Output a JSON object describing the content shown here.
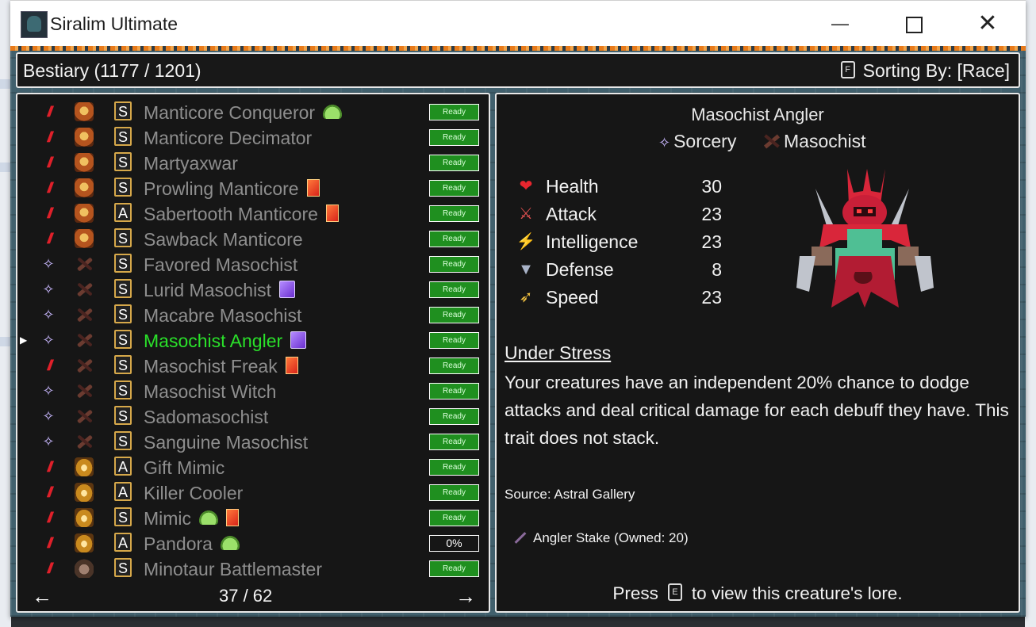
{
  "window": {
    "title": "Siralim Ultimate",
    "minimize_icon": "minimize-icon",
    "maximize_icon": "maximize-icon",
    "close_icon": "close-icon"
  },
  "header": {
    "title": "Bestiary (1177 / 1201)",
    "sort_key": "F",
    "sort_label": "Sorting By: [Race]"
  },
  "list": {
    "selected_index": 9,
    "rows": [
      {
        "klass": "nature",
        "race": "manticore",
        "rank": "S",
        "name": "Manticore Conqueror",
        "badges": [
          "slime"
        ],
        "status": "Ready"
      },
      {
        "klass": "nature",
        "race": "manticore",
        "rank": "S",
        "name": "Manticore Decimator",
        "badges": [],
        "status": "Ready"
      },
      {
        "klass": "nature",
        "race": "manticore",
        "rank": "S",
        "name": "Martyaxwar",
        "badges": [],
        "status": "Ready"
      },
      {
        "klass": "nature",
        "race": "manticore",
        "rank": "S",
        "name": "Prowling Manticore",
        "badges": [
          "card"
        ],
        "status": "Ready"
      },
      {
        "klass": "nature",
        "race": "manticore",
        "rank": "A",
        "name": "Sabertooth Manticore",
        "badges": [
          "card"
        ],
        "status": "Ready"
      },
      {
        "klass": "nature",
        "race": "manticore",
        "rank": "S",
        "name": "Sawback Manticore",
        "badges": [],
        "status": "Ready"
      },
      {
        "klass": "sorcery",
        "race": "masochist",
        "rank": "S",
        "name": "Favored Masochist",
        "badges": [],
        "status": "Ready"
      },
      {
        "klass": "sorcery",
        "race": "masochist",
        "rank": "S",
        "name": "Lurid Masochist",
        "badges": [
          "purple"
        ],
        "status": "Ready"
      },
      {
        "klass": "sorcery",
        "race": "masochist",
        "rank": "S",
        "name": "Macabre Masochist",
        "badges": [],
        "status": "Ready"
      },
      {
        "klass": "sorcery",
        "race": "masochist",
        "rank": "S",
        "name": "Masochist Angler",
        "badges": [
          "purple"
        ],
        "status": "Ready"
      },
      {
        "klass": "nature",
        "race": "masochist",
        "rank": "S",
        "name": "Masochist Freak",
        "badges": [
          "card"
        ],
        "status": "Ready"
      },
      {
        "klass": "sorcery",
        "race": "masochist",
        "rank": "S",
        "name": "Masochist Witch",
        "badges": [],
        "status": "Ready"
      },
      {
        "klass": "sorcery",
        "race": "masochist",
        "rank": "S",
        "name": "Sadomasochist",
        "badges": [],
        "status": "Ready"
      },
      {
        "klass": "sorcery",
        "race": "masochist",
        "rank": "S",
        "name": "Sanguine Masochist",
        "badges": [],
        "status": "Ready"
      },
      {
        "klass": "nature",
        "race": "mimic",
        "rank": "A",
        "name": "Gift Mimic",
        "badges": [],
        "status": "Ready"
      },
      {
        "klass": "nature",
        "race": "mimic",
        "rank": "A",
        "name": "Killer Cooler",
        "badges": [],
        "status": "Ready"
      },
      {
        "klass": "nature",
        "race": "mimic",
        "rank": "S",
        "name": "Mimic",
        "badges": [
          "slime",
          "card"
        ],
        "status": "Ready"
      },
      {
        "klass": "nature",
        "race": "mimic",
        "rank": "A",
        "name": "Pandora",
        "badges": [
          "slime"
        ],
        "status": "0%"
      },
      {
        "klass": "nature",
        "race": "minotaur",
        "rank": "S",
        "name": "Minotaur Battlemaster",
        "badges": [],
        "status": "Ready"
      }
    ],
    "page": "37 / 62",
    "prev_glyph": "←",
    "next_glyph": "→"
  },
  "detail": {
    "name": "Masochist Angler",
    "klass": "Sorcery",
    "race": "Masochist",
    "stats": [
      {
        "icon": "heart-icon",
        "glyph": "❤",
        "color": "#e8262e",
        "label": "Health",
        "value": "30"
      },
      {
        "icon": "sword-icon",
        "glyph": "⚔",
        "color": "#e05050",
        "label": "Attack",
        "value": "23"
      },
      {
        "icon": "lightning-icon",
        "glyph": "⚡",
        "color": "#4aa0ff",
        "label": "Intelligence",
        "value": "23"
      },
      {
        "icon": "shield-icon",
        "glyph": "▼",
        "color": "#a9b3c8",
        "label": "Defense",
        "value": "8"
      },
      {
        "icon": "wing-icon",
        "glyph": "➶",
        "color": "#f0c040",
        "label": "Speed",
        "value": "23"
      }
    ],
    "trait_title": "Under Stress",
    "trait_text": "Your creatures have an independent 20% chance to dodge attacks and deal critical damage for each debuff they have. This trait does not stack.",
    "source": "Source: Astral Gallery",
    "item": "Angler Stake (Owned: 20)",
    "lore_press": "Press",
    "lore_key": "E",
    "lore_rest": "to view this creature's lore."
  },
  "colors": {
    "ready_green": "#1f8f1f",
    "selected_name": "#2ae02a",
    "panel_bg": "#161616",
    "panel_border": "#e8e8e8"
  }
}
